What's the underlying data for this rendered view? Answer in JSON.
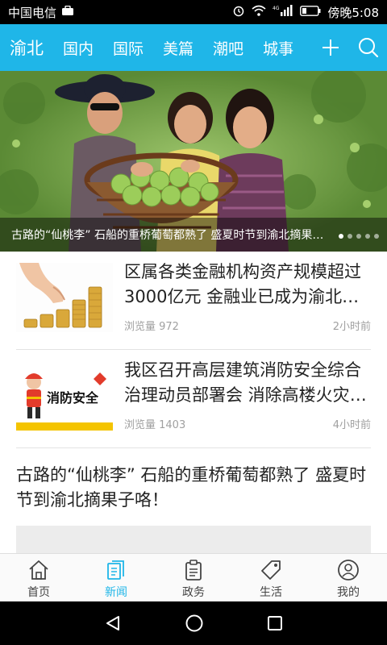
{
  "status": {
    "carrier": "中国电信",
    "time_label": "傍晚5:08"
  },
  "nav": {
    "tabs": [
      "渝北",
      "国内",
      "国际",
      "美篇",
      "潮吧",
      "城事"
    ]
  },
  "banner": {
    "caption": "古路的“仙桃李” 石船的重桥葡萄都熟了 盛夏时节到渝北摘果子咯！",
    "page_total": 5,
    "page_current": 1
  },
  "news": [
    {
      "title": "区属各类金融机构资产规模超过3000亿元 金融业已成为渝北经济发展重要支柱",
      "views": "浏览量 972",
      "time": "2小时前",
      "thumb_icon": "coins-hand-thumbnail"
    },
    {
      "title": "我区召开高层建筑消防安全综合治理动员部署会 消除高楼火灾隐患",
      "views": "浏览量 1403",
      "time": "4小时前",
      "thumb_icon": "fire-safety-thumbnail",
      "thumb_text": "消防安全"
    }
  ],
  "feature": {
    "title": "古路的“仙桃李” 石船的重桥葡萄都熟了 盛夏时节到渝北摘果子咯！"
  },
  "tabbar": {
    "items": [
      {
        "label": "首页",
        "icon": "home-icon"
      },
      {
        "label": "新闻",
        "icon": "news-icon"
      },
      {
        "label": "政务",
        "icon": "clipboard-icon"
      },
      {
        "label": "生活",
        "icon": "tag-icon"
      },
      {
        "label": "我的",
        "icon": "user-icon"
      }
    ],
    "active_index": 1
  },
  "colors": {
    "accent": "#1fb6e8",
    "text": "#222222",
    "meta": "#a0a0a0"
  }
}
